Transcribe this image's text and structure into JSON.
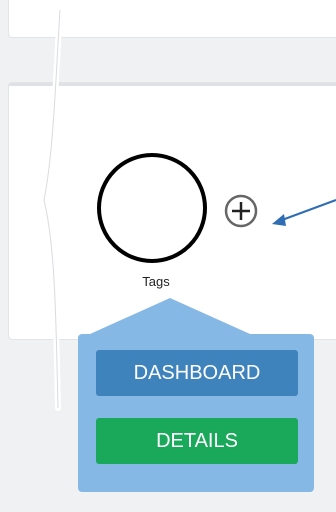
{
  "node": {
    "label": "Tags"
  },
  "add_button": {
    "icon": "plus-icon",
    "symbol": "+"
  },
  "popover": {
    "buttons": [
      {
        "label": "DASHBOARD",
        "color": "#3f83bd"
      },
      {
        "label": "DETAILS",
        "color": "#1aa85a"
      }
    ],
    "background": "#86b8e6"
  },
  "annotation": {
    "arrow_color": "#2f6db5"
  },
  "colors": {
    "page_bg": "#f0f1f3",
    "card_bg": "#ffffff"
  }
}
